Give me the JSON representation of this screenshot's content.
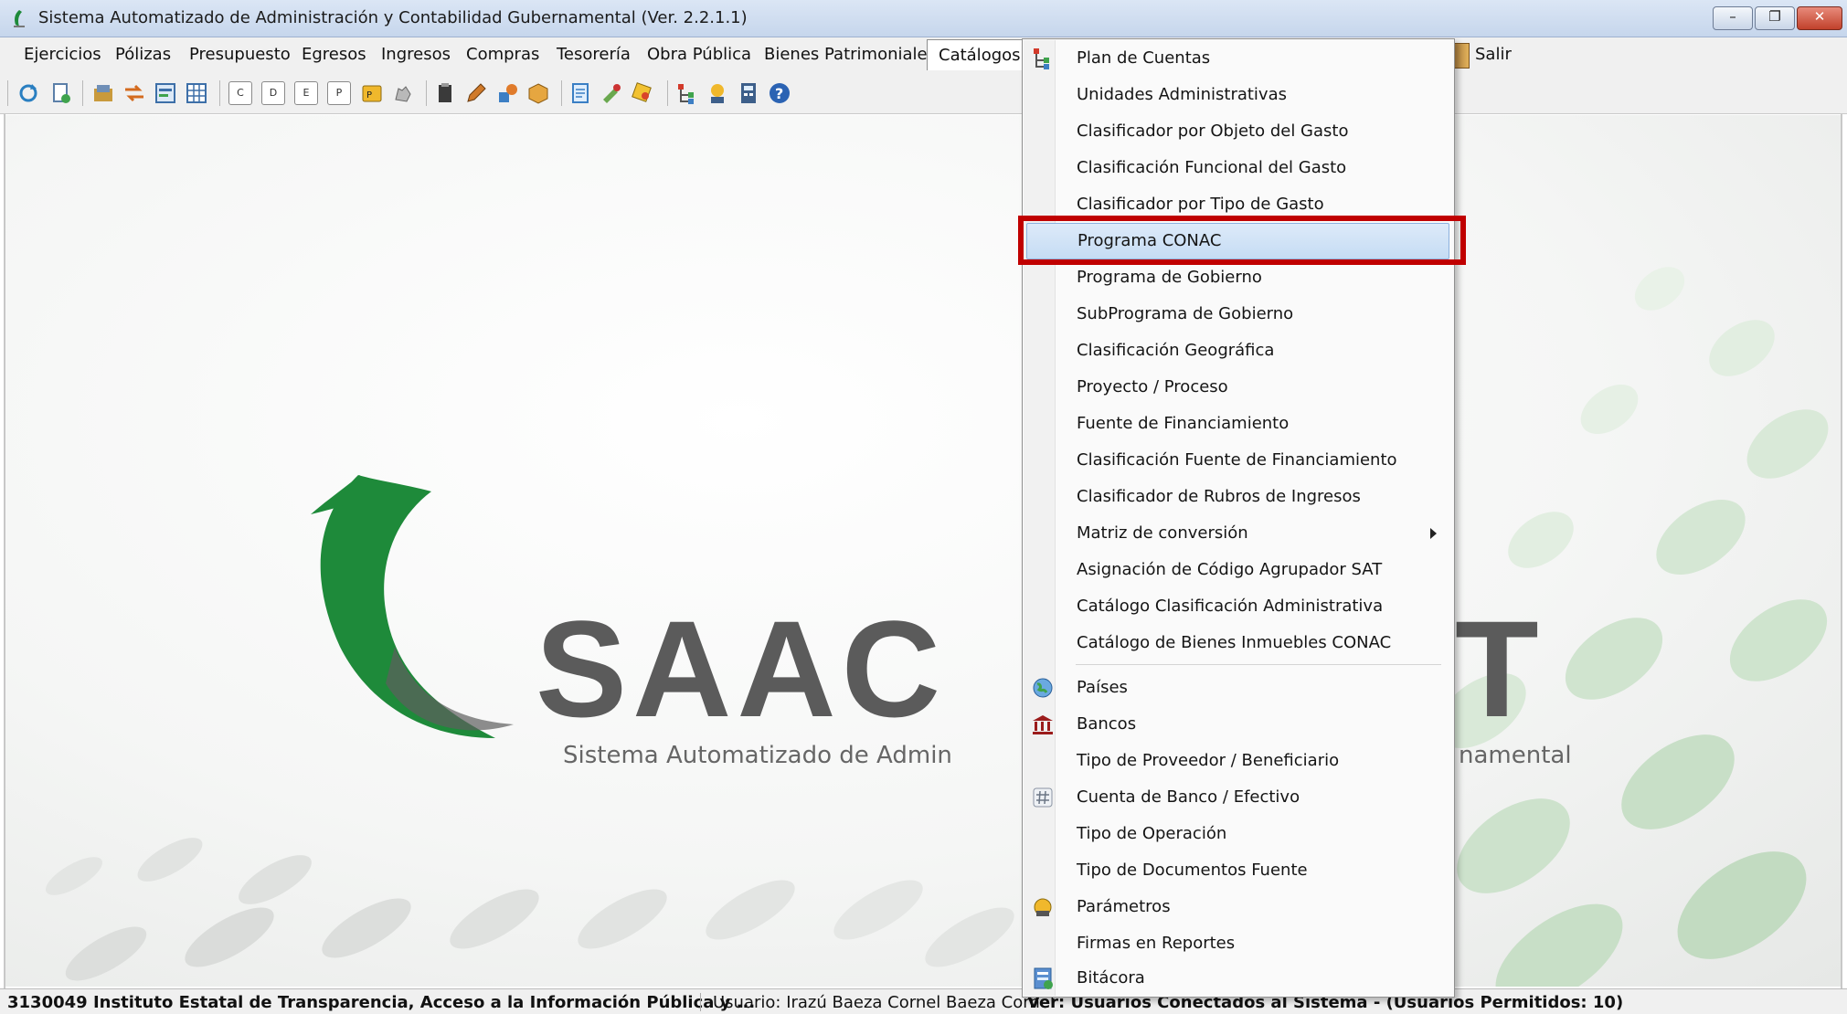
{
  "window": {
    "title": "Sistema Automatizado de Administración y Contabilidad Gubernamental  (Ver. 2.2.1.1)",
    "buttons": {
      "minimize": "–",
      "restore": "❐",
      "close": "✕"
    }
  },
  "menubar": {
    "items": [
      "Ejercicios",
      "Pólizas",
      "Presupuesto",
      "Egresos",
      "Ingresos",
      "Compras",
      "Tesorería",
      "Obra Pública",
      "Bienes Patrimoniales",
      "Catálogos"
    ],
    "active": "Catálogos",
    "exit_label": "Salir"
  },
  "toolbar": {
    "letter_buttons": [
      "C",
      "D",
      "E",
      "P"
    ]
  },
  "logo": {
    "name_left": "SAAC",
    "name_right": "ET",
    "subtitle_left": "Sistema Automatizado de Admin",
    "subtitle_right": "namental"
  },
  "dropdown": {
    "items": [
      {
        "label": "Plan de Cuentas",
        "icon": "tree-icon"
      },
      {
        "label": "Unidades Administrativas"
      },
      {
        "label": "Clasificador por Objeto del Gasto"
      },
      {
        "label": "Clasificación Funcional del Gasto"
      },
      {
        "label": "Clasificador por Tipo de Gasto"
      },
      {
        "label": "Programa CONAC",
        "highlighted": true
      },
      {
        "label": "Programa de Gobierno"
      },
      {
        "label": "SubPrograma de Gobierno"
      },
      {
        "label": "Clasificación Geográfica"
      },
      {
        "label": "Proyecto / Proceso"
      },
      {
        "label": "Fuente de Financiamiento"
      },
      {
        "label": "Clasificación Fuente de Financiamiento"
      },
      {
        "label": "Clasificador de Rubros de Ingresos"
      },
      {
        "label": "Matriz de conversión",
        "submenu": true
      },
      {
        "label": "Asignación de Código Agrupador SAT"
      },
      {
        "label": "Catálogo Clasificación Administrativa"
      },
      {
        "label": "Catálogo de Bienes Inmuebles CONAC"
      },
      {
        "label": "Países",
        "icon": "globe-icon"
      },
      {
        "label": "Bancos",
        "icon": "bank-icon"
      },
      {
        "label": "Tipo de Proveedor / Beneficiario"
      },
      {
        "label": "Cuenta de Banco / Efectivo",
        "icon": "hash-icon"
      },
      {
        "label": "Tipo de Operación"
      },
      {
        "label": "Tipo de Documentos Fuente"
      },
      {
        "label": "Parámetros",
        "icon": "parameters-icon"
      },
      {
        "label": "Firmas en Reportes"
      },
      {
        "label": "Bitácora",
        "icon": "log-icon"
      }
    ]
  },
  "status": {
    "entity": "3130049 Instituto Estatal de Transparencia, Acceso a la Información Pública y ...",
    "user": "Usuario: Irazú Baeza Cornel Baeza Cornel",
    "connected": "Ver: Usuarios Conectados al Sistema - (Usuarios Permitidos: 10)"
  },
  "colors": {
    "highlight_border": "#c00000",
    "logo_green": "#1e8a3a",
    "logo_gray": "#5b5b5b",
    "dots_green": "#cfe4cf"
  }
}
